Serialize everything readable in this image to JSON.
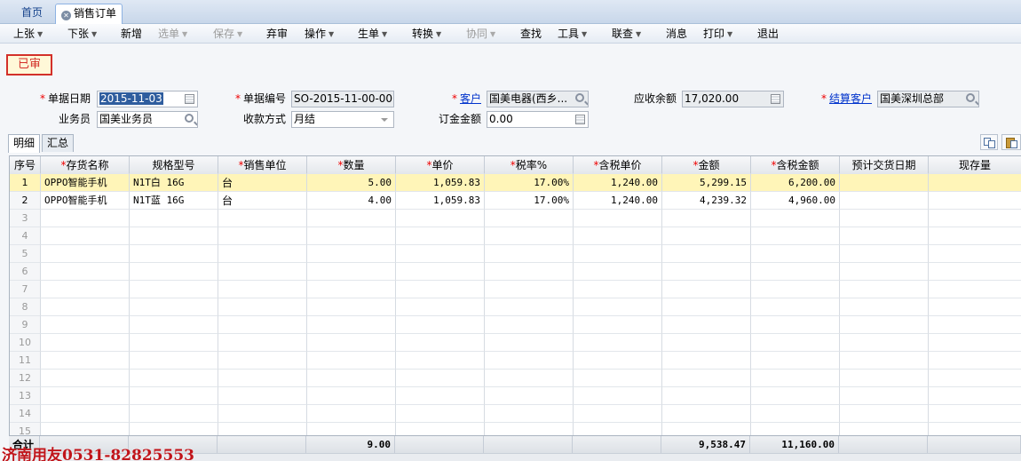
{
  "tabs": {
    "home": "首页",
    "active": "销售订单"
  },
  "toolbar": [
    {
      "label": "上张",
      "arrow": true,
      "disabled": false
    },
    {
      "label": "下张",
      "arrow": true,
      "disabled": false
    },
    {
      "label": "新增",
      "arrow": false,
      "disabled": false
    },
    {
      "label": "选单",
      "arrow": true,
      "disabled": true
    },
    {
      "label": "保存",
      "arrow": true,
      "disabled": true
    },
    {
      "label": "弃审",
      "arrow": false,
      "disabled": false
    },
    {
      "label": "操作",
      "arrow": true,
      "disabled": false
    },
    {
      "label": "生单",
      "arrow": true,
      "disabled": false
    },
    {
      "label": "转换",
      "arrow": true,
      "disabled": false
    },
    {
      "label": "协同",
      "arrow": true,
      "disabled": true
    },
    {
      "label": "查找",
      "arrow": false,
      "disabled": false
    },
    {
      "label": "工具",
      "arrow": true,
      "disabled": false
    },
    {
      "label": "联查",
      "arrow": true,
      "disabled": false
    },
    {
      "label": "消息",
      "arrow": false,
      "disabled": false
    },
    {
      "label": "打印",
      "arrow": true,
      "disabled": false
    },
    {
      "label": "退出",
      "arrow": false,
      "disabled": false
    }
  ],
  "status": "已审",
  "form": {
    "date_label": "单据日期",
    "date_value": "2015-11-03",
    "number_label": "单据编号",
    "number_value": "SO-2015-11-00-00...",
    "customer_label": "客户",
    "customer_value": "国美电器(西乡...",
    "receivable_label": "应收余额",
    "receivable_value": "17,020.00",
    "settle_label": "结算客户",
    "settle_value": "国美深圳总部",
    "salesman_label": "业务员",
    "salesman_value": "国美业务员",
    "payment_label": "收款方式",
    "payment_value": "月结",
    "deposit_label": "订金金额",
    "deposit_value": "0.00"
  },
  "subtabs": {
    "detail": "明细",
    "summary": "汇总"
  },
  "grid": {
    "headers": [
      "序号",
      "存货名称",
      "规格型号",
      "销售单位",
      "数量",
      "单价",
      "税率%",
      "含税单价",
      "金额",
      "含税金额",
      "预计交货日期",
      "现存量"
    ],
    "required": [
      false,
      true,
      false,
      true,
      true,
      true,
      true,
      true,
      true,
      true,
      false,
      false
    ],
    "rows": [
      {
        "seq": "1",
        "name": "OPPO智能手机",
        "spec": "N1T白 16G",
        "unit": "台",
        "qty": "5.00",
        "price": "1,059.83",
        "tax": "17.00%",
        "taxprice": "1,240.00",
        "amount": "5,299.15",
        "taxamount": "6,200.00",
        "delivery": "",
        "stock": ""
      },
      {
        "seq": "2",
        "name": "OPPO智能手机",
        "spec": "N1T蓝 16G",
        "unit": "台",
        "qty": "4.00",
        "price": "1,059.83",
        "tax": "17.00%",
        "taxprice": "1,240.00",
        "amount": "4,239.32",
        "taxamount": "4,960.00",
        "delivery": "",
        "stock": ""
      }
    ],
    "empty_seq": [
      "3",
      "4",
      "5",
      "6",
      "7",
      "8",
      "9",
      "10",
      "11",
      "12",
      "13",
      "14",
      "15"
    ],
    "totals": {
      "label": "合计",
      "qty": "9.00",
      "amount": "9,538.47",
      "taxamount": "11,160.00"
    }
  },
  "watermark": "济南用友0531-82825553"
}
